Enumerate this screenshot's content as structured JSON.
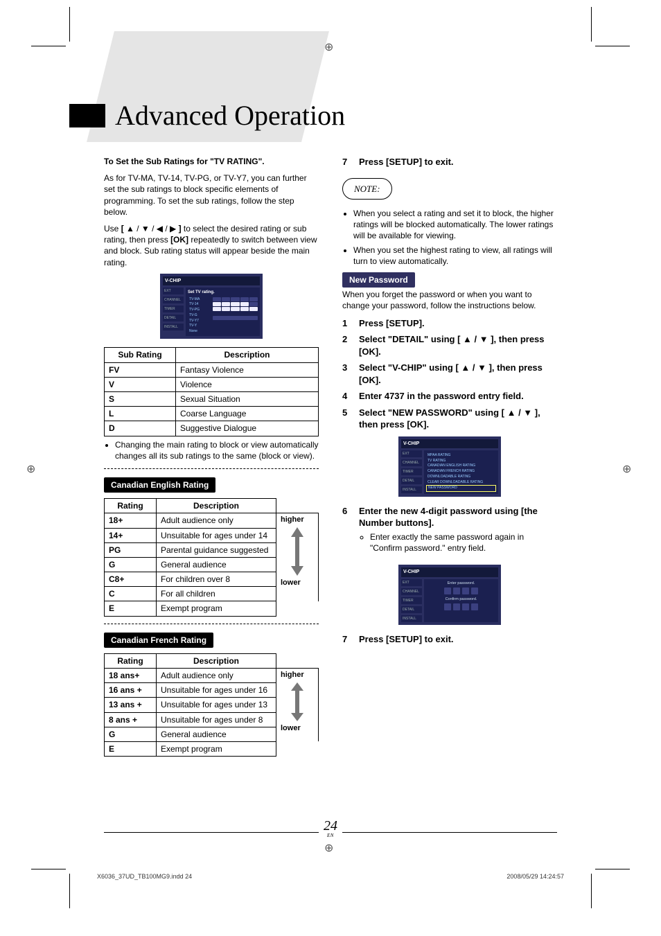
{
  "chapter_title": "Advanced Operation",
  "left_col": {
    "sub_rating_heading": "To Set the Sub Ratings for \"TV RATING\".",
    "sub_rating_para": "As for TV-MA, TV-14, TV-PG, or TV-Y7, you can further set the sub ratings to block specific elements of programming. To set the sub ratings, follow the step below.",
    "use_para": "Use [ ▲ / ▼ / ◀ / ▶ ] to select the desired rating or sub rating, then press [OK] repeatedly to switch between view and block. Sub rating status will appear beside the main rating.",
    "menu1": {
      "header": "V-CHIP",
      "title": "Set TV rating.",
      "side": [
        "EXT",
        "CHANNEL",
        "TIMER",
        "DETAIL",
        "INSTALL"
      ],
      "lines": [
        "TV-MA",
        "TV-14",
        "TV-PG",
        "TV-G",
        "TV-Y7",
        "TV-Y",
        "None"
      ]
    },
    "subrating_table": {
      "headers": [
        "Sub Rating",
        "Description"
      ],
      "rows": [
        [
          "FV",
          "Fantasy Violence"
        ],
        [
          "V",
          "Violence"
        ],
        [
          "S",
          "Sexual Situation"
        ],
        [
          "L",
          "Coarse Language"
        ],
        [
          "D",
          "Suggestive Dialogue"
        ]
      ]
    },
    "bullet1": "Changing the main rating to block or view automatically changes all its sub ratings to the same (block or view).",
    "can_en_heading": "Canadian English Rating",
    "can_en_table": {
      "headers": [
        "Rating",
        "Description"
      ],
      "higher": "higher",
      "lower": "lower",
      "rows": [
        [
          "18+",
          "Adult audience only"
        ],
        [
          "14+",
          "Unsuitable for ages under 14"
        ],
        [
          "PG",
          "Parental guidance suggested"
        ],
        [
          "G",
          "General audience"
        ],
        [
          "C8+",
          "For children over 8"
        ],
        [
          "C",
          "For all children"
        ],
        [
          "E",
          "Exempt program"
        ]
      ]
    },
    "can_fr_heading": "Canadian French Rating",
    "can_fr_table": {
      "headers": [
        "Rating",
        "Description"
      ],
      "higher": "higher",
      "lower": "lower",
      "rows": [
        [
          "18 ans+",
          "Adult audience only"
        ],
        [
          "16 ans +",
          "Unsuitable for ages under 16"
        ],
        [
          "13 ans +",
          "Unsuitable for ages under 13"
        ],
        [
          "8 ans +",
          "Unsuitable for ages under 8"
        ],
        [
          "G",
          "General audience"
        ],
        [
          "E",
          "Exempt program"
        ]
      ]
    }
  },
  "right_col": {
    "step7a": "Press [SETUP] to exit.",
    "note_label": "NOTE:",
    "note_bullets": [
      "When you select a rating and set it to block, the higher ratings will be blocked automatically. The lower ratings will be available for viewing.",
      "When you set the highest rating to view, all ratings will turn to view automatically."
    ],
    "new_pw_heading": "New Password",
    "new_pw_para": "When you forget the password or when you want to change your password, follow the instructions below.",
    "steps": [
      {
        "n": "1",
        "t": "Press [SETUP]."
      },
      {
        "n": "2",
        "t": "Select \"DETAIL\" using [ ▲ / ▼ ], then press [OK]."
      },
      {
        "n": "3",
        "t": "Select \"V-CHIP\" using [ ▲ / ▼ ], then press [OK]."
      },
      {
        "n": "4",
        "t": "Enter 4737 in the password entry field."
      },
      {
        "n": "5",
        "t": "Select \"NEW PASSWORD\" using [ ▲ / ▼ ], then press [OK]."
      }
    ],
    "menu2": {
      "header": "V-CHIP",
      "side": [
        "EXT",
        "CHANNEL",
        "TIMER",
        "DETAIL",
        "INSTALL"
      ],
      "lines": [
        "MPAA RATING",
        "TV RATING",
        "CANADIAN ENGLISH RATING",
        "CANADIAN FRENCH RATING",
        "DOWNLOADABLE RATING",
        "CLEAR DOWNLOADABLE RATING",
        "NEW PASSWORD"
      ]
    },
    "step6": {
      "n": "6",
      "t": "Enter the new 4-digit password using [the Number buttons].",
      "sub": "Enter exactly the same password again in \"Confirm password.\" entry field."
    },
    "menu3": {
      "header": "V-CHIP",
      "side": [
        "EXT",
        "CHANNEL",
        "TIMER",
        "DETAIL",
        "INSTALL"
      ],
      "enter": "Enter password.",
      "confirm": "Confirm password."
    },
    "step7b": {
      "n": "7",
      "t": "Press [SETUP] to exit."
    }
  },
  "footer": {
    "page": "24",
    "en": "EN",
    "left": "X6036_37UD_TB100MG9.indd   24",
    "right": "2008/05/29   14:24:57"
  }
}
